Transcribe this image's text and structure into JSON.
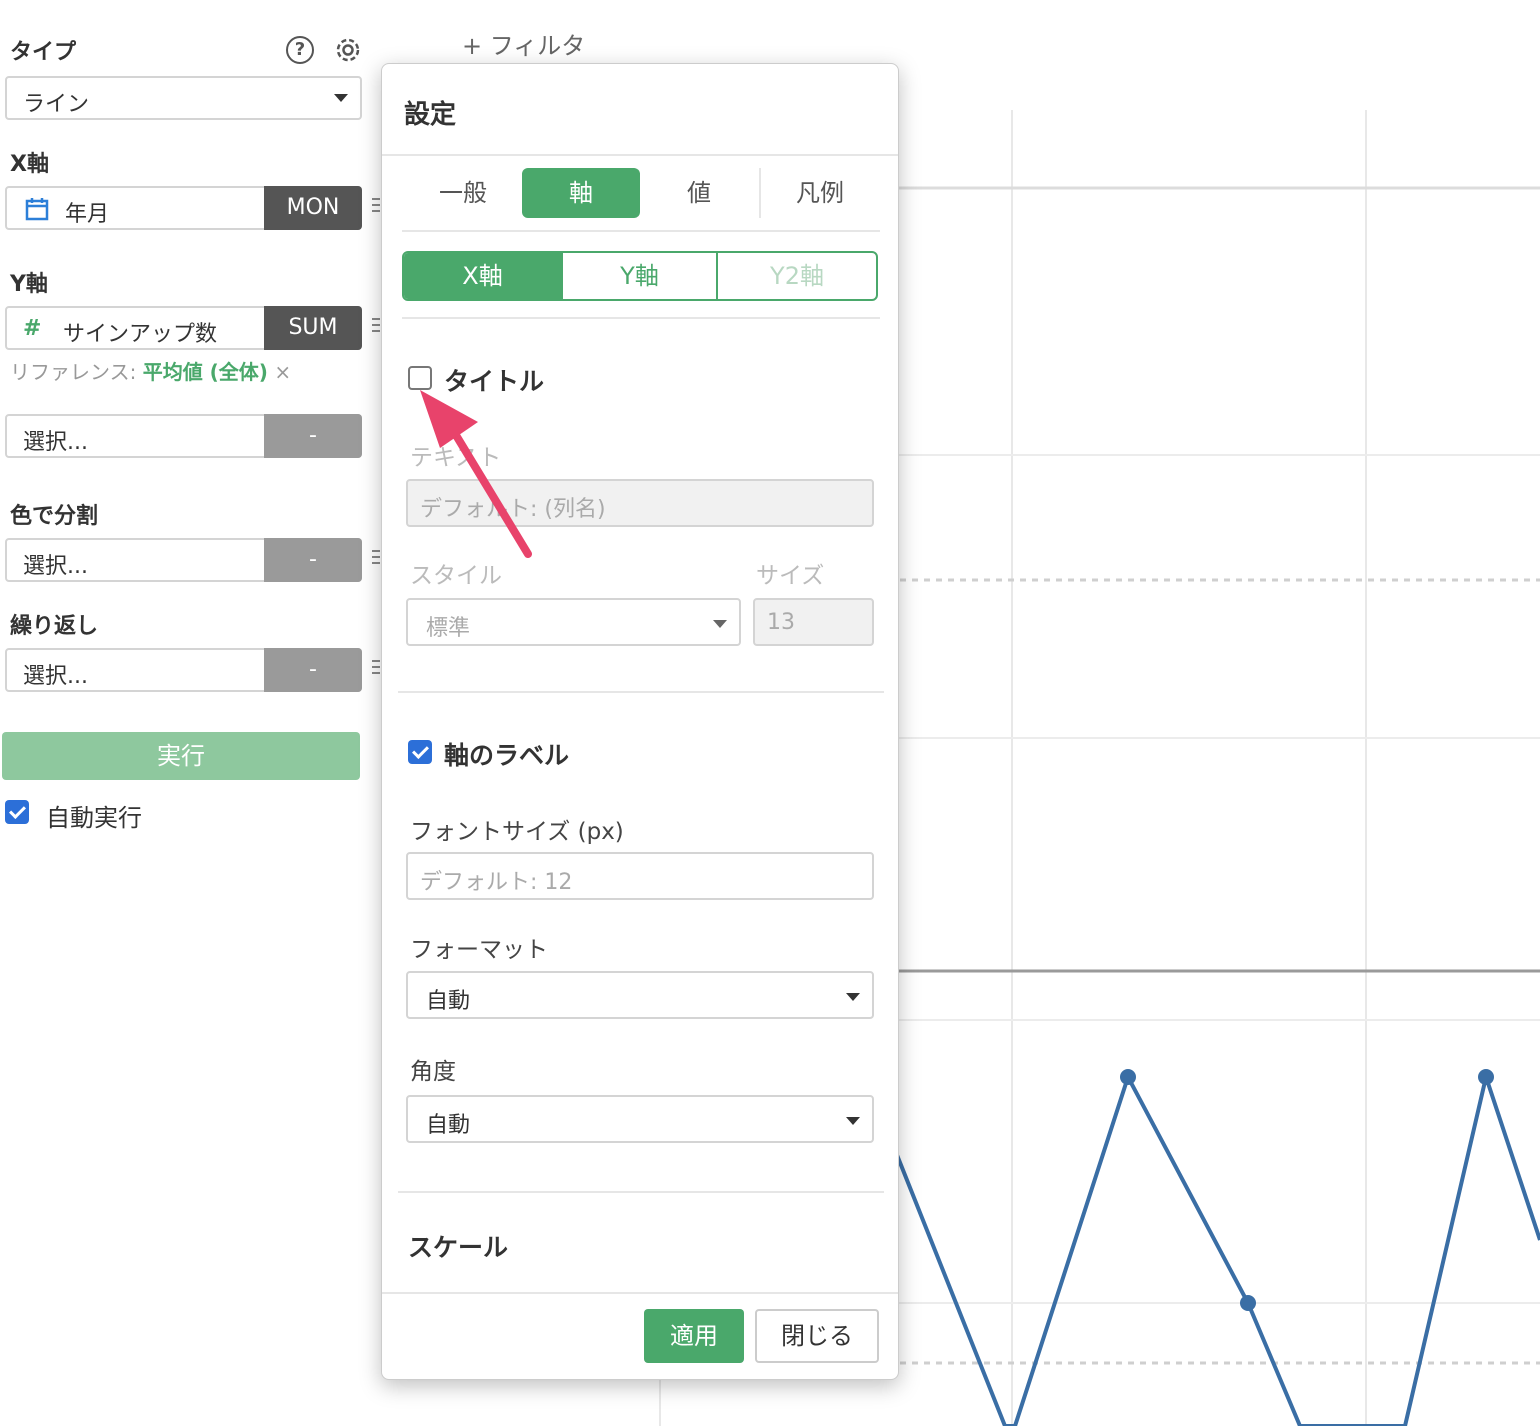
{
  "left_panel": {
    "type_label": "タイプ",
    "type_value": "ライン",
    "x_axis_label": "X軸",
    "x_axis_field": "年月",
    "x_axis_agg": "MON",
    "y_axis_label": "Y軸",
    "y_axis_field": "サインアップ数",
    "y_axis_agg": "SUM",
    "y_axis_hash": "#",
    "reference_prefix": "リファレンス:",
    "reference_value": "平均値 (全体)",
    "reference_remove": "×",
    "y2_select": "選択...",
    "y2_agg": "-",
    "color_label": "色で分割",
    "color_select": "選択...",
    "color_agg": "-",
    "repeat_label": "繰り返し",
    "repeat_select": "選択...",
    "repeat_agg": "-",
    "run_button": "実行",
    "auto_run_label": "自動実行",
    "auto_run_checked": true,
    "help_glyph": "?"
  },
  "toolbar": {
    "filter_label": "+ フィルタ"
  },
  "modal": {
    "title": "設定",
    "tabs": [
      {
        "label": "一般",
        "active": false
      },
      {
        "label": "軸",
        "active": true
      },
      {
        "label": "値",
        "active": false
      },
      {
        "label": "凡例",
        "active": false
      }
    ],
    "axis_tabs": [
      {
        "label": "X軸",
        "state": "active"
      },
      {
        "label": "Y軸",
        "state": "normal"
      },
      {
        "label": "Y2軸",
        "state": "disabled"
      }
    ],
    "title_section": {
      "heading": "タイトル",
      "checked": false,
      "text_label": "テキスト",
      "text_placeholder": "デフォルト: (列名)",
      "style_label": "スタイル",
      "style_value": "標準",
      "size_label": "サイズ",
      "size_value": "13"
    },
    "label_section": {
      "heading": "軸のラベル",
      "checked": true,
      "font_size_label": "フォントサイズ (px)",
      "font_size_placeholder": "デフォルト: 12",
      "format_label": "フォーマット",
      "format_value": "自動",
      "angle_label": "角度",
      "angle_value": "自動"
    },
    "scale_heading": "スケール",
    "apply_button": "適用",
    "close_button": "閉じる"
  },
  "colors": {
    "accent": "#4aa86b",
    "line": "#3a6ea5",
    "arrow": "#e8436b",
    "checkbox": "#2c6fd8"
  }
}
